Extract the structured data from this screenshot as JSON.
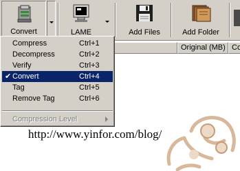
{
  "toolbar": {
    "convert_label": "Convert",
    "lame_label": "LAME",
    "add_files_label": "Add Files",
    "add_folder_label": "Add Folder"
  },
  "columns": {
    "original": "Original (MB)",
    "next": "Co"
  },
  "menu": {
    "items": [
      {
        "label": "Compress",
        "shortcut": "Ctrl+1"
      },
      {
        "label": "Decompress",
        "shortcut": "Ctrl+2"
      },
      {
        "label": "Verify",
        "shortcut": "Ctrl+3"
      },
      {
        "label": "Convert",
        "shortcut": "Ctrl+4"
      },
      {
        "label": "Tag",
        "shortcut": "Ctrl+5"
      },
      {
        "label": "Remove Tag",
        "shortcut": "Ctrl+6"
      }
    ],
    "disabled_item": "Compression Level",
    "selected_index": 3
  },
  "url_text": "http://www.yinfor.com/blog/",
  "colors": {
    "toolbar_bg": "#d4d0c8",
    "selection": "#0a246a"
  }
}
